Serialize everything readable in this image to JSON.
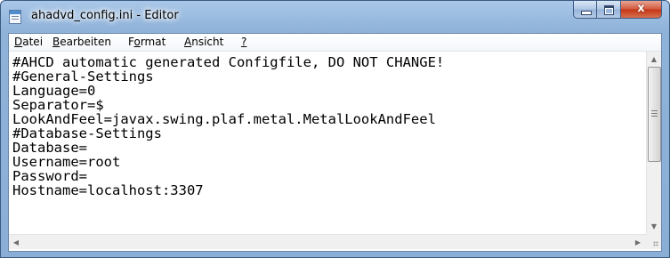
{
  "window": {
    "title": "ahadvd_config.ini - Editor"
  },
  "caption_buttons": {
    "close_glyph": "x"
  },
  "menu": {
    "items": [
      {
        "mnemonic": "D",
        "rest": "atei"
      },
      {
        "mnemonic": "B",
        "rest": "earbeiten"
      },
      {
        "pre": "F",
        "mnemonic": "o",
        "rest": "rmat"
      },
      {
        "mnemonic": "A",
        "rest": "nsicht"
      },
      {
        "mnemonic": "?",
        "rest": ""
      }
    ]
  },
  "editor": {
    "lines": [
      "#AHCD automatic generated Configfile, DO NOT CHANGE!",
      "#General-Settings",
      "Language=0",
      "Separator=$",
      "LookAndFeel=javax.swing.plaf.metal.MetalLookAndFeel",
      "#Database-Settings",
      "Database=",
      "Username=root",
      "Password=",
      "Hostname=localhost:3307"
    ]
  },
  "scrollbars": {
    "up_glyph": "▲",
    "down_glyph": "▼",
    "left_glyph": "◀",
    "right_glyph": "▶"
  }
}
